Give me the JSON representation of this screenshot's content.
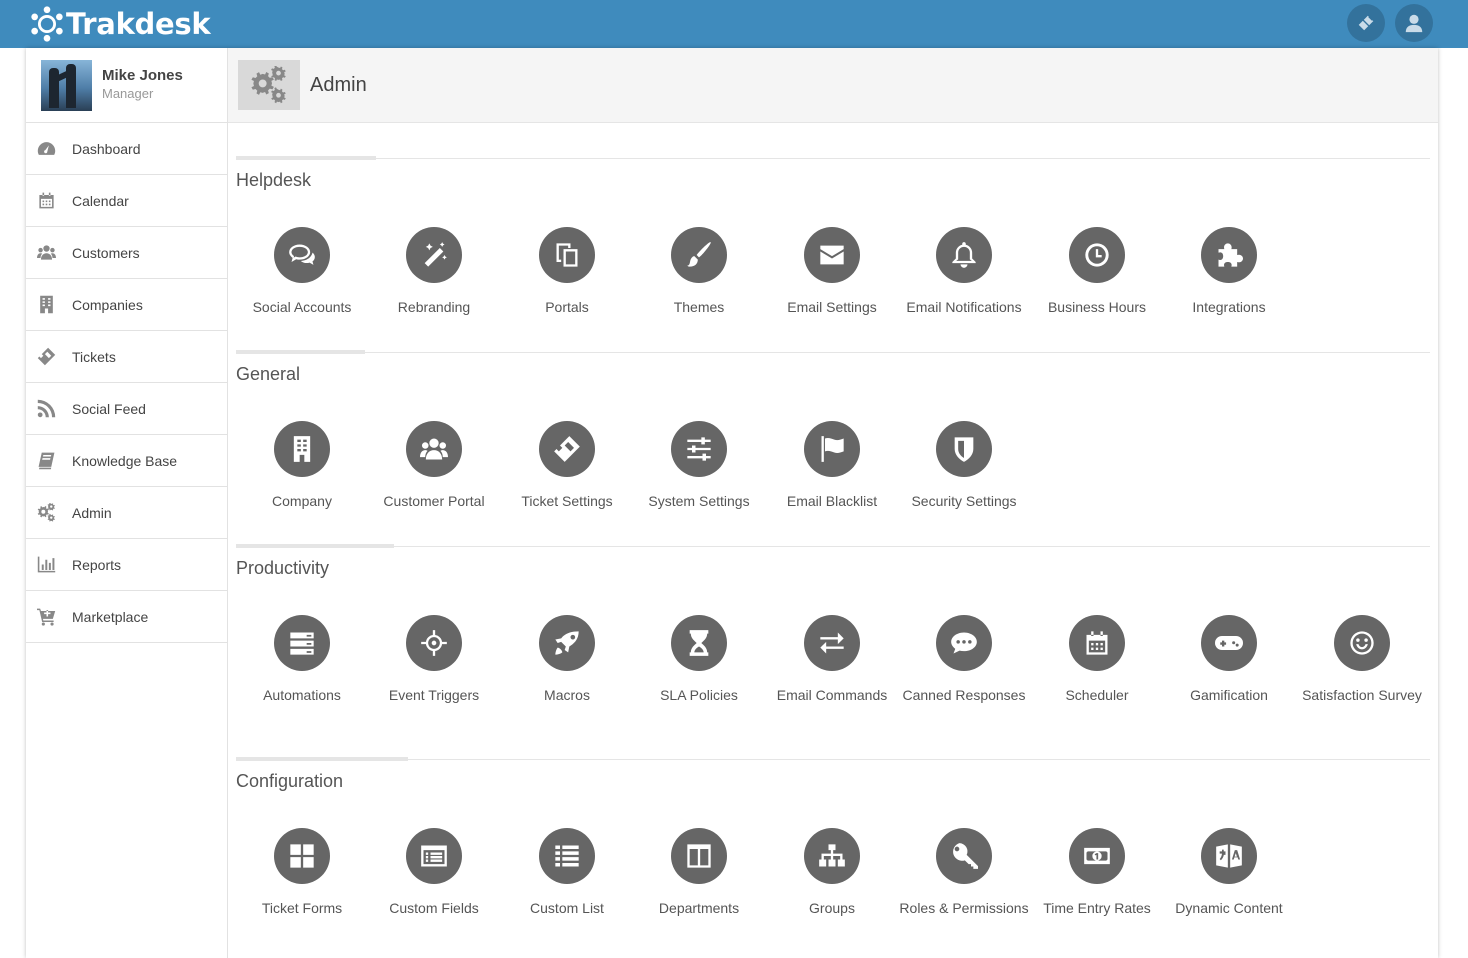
{
  "app": {
    "name": "Trakdesk"
  },
  "topbar": {
    "actions": [
      {
        "icon": "ticket-icon"
      },
      {
        "icon": "user-icon"
      }
    ]
  },
  "user": {
    "name": "Mike Jones",
    "role": "Manager"
  },
  "sidebar": {
    "items": [
      {
        "label": "Dashboard",
        "icon": "dashboard-icon"
      },
      {
        "label": "Calendar",
        "icon": "calendar-icon"
      },
      {
        "label": "Customers",
        "icon": "customers-icon"
      },
      {
        "label": "Companies",
        "icon": "building-icon"
      },
      {
        "label": "Tickets",
        "icon": "ticket-icon"
      },
      {
        "label": "Social Feed",
        "icon": "rss-icon"
      },
      {
        "label": "Knowledge Base",
        "icon": "book-icon"
      },
      {
        "label": "Admin",
        "icon": "gears-icon"
      },
      {
        "label": "Reports",
        "icon": "bar-chart-icon"
      },
      {
        "label": "Marketplace",
        "icon": "cart-icon"
      }
    ]
  },
  "page": {
    "title": "Admin",
    "icon": "gears-icon"
  },
  "sections": [
    {
      "title": "Helpdesk",
      "items": [
        {
          "label": "Social Accounts",
          "icon": "comments-icon"
        },
        {
          "label": "Rebranding",
          "icon": "magic-wand-icon"
        },
        {
          "label": "Portals",
          "icon": "copy-icon"
        },
        {
          "label": "Themes",
          "icon": "paint-brush-icon"
        },
        {
          "label": "Email Settings",
          "icon": "envelope-icon"
        },
        {
          "label": "Email Notifications",
          "icon": "bell-icon"
        },
        {
          "label": "Business Hours",
          "icon": "clock-icon"
        },
        {
          "label": "Integrations",
          "icon": "puzzle-icon"
        }
      ]
    },
    {
      "title": "General",
      "items": [
        {
          "label": "Company",
          "icon": "building-icon"
        },
        {
          "label": "Customer Portal",
          "icon": "users-icon"
        },
        {
          "label": "Ticket Settings",
          "icon": "ticket-icon"
        },
        {
          "label": "System Settings",
          "icon": "sliders-icon"
        },
        {
          "label": "Email Blacklist",
          "icon": "flag-icon"
        },
        {
          "label": "Security Settings",
          "icon": "shield-icon"
        }
      ]
    },
    {
      "title": "Productivity",
      "items": [
        {
          "label": "Automations",
          "icon": "server-icon"
        },
        {
          "label": "Event Triggers",
          "icon": "crosshairs-icon"
        },
        {
          "label": "Macros",
          "icon": "rocket-icon"
        },
        {
          "label": "SLA Policies",
          "icon": "hourglass-icon"
        },
        {
          "label": "Email Commands",
          "icon": "exchange-icon"
        },
        {
          "label": "Canned Responses",
          "icon": "comment-dots-icon"
        },
        {
          "label": "Scheduler",
          "icon": "calendar-icon"
        },
        {
          "label": "Gamification",
          "icon": "gamepad-icon"
        },
        {
          "label": "Satisfaction Survey",
          "icon": "smile-icon"
        }
      ]
    },
    {
      "title": "Configuration",
      "items": [
        {
          "label": "Ticket Forms",
          "icon": "grid-icon"
        },
        {
          "label": "Custom Fields",
          "icon": "list-alt-icon"
        },
        {
          "label": "Custom List",
          "icon": "list-icon"
        },
        {
          "label": "Departments",
          "icon": "columns-icon"
        },
        {
          "label": "Groups",
          "icon": "sitemap-icon"
        },
        {
          "label": "Roles & Permissions",
          "icon": "key-icon"
        },
        {
          "label": "Time Entry Rates",
          "icon": "money-icon"
        },
        {
          "label": "Dynamic Content",
          "icon": "language-icon"
        }
      ]
    }
  ],
  "colors": {
    "topbar": "#3f8bbd",
    "tile_circle": "#666666",
    "sidebar_icon": "#888888"
  }
}
